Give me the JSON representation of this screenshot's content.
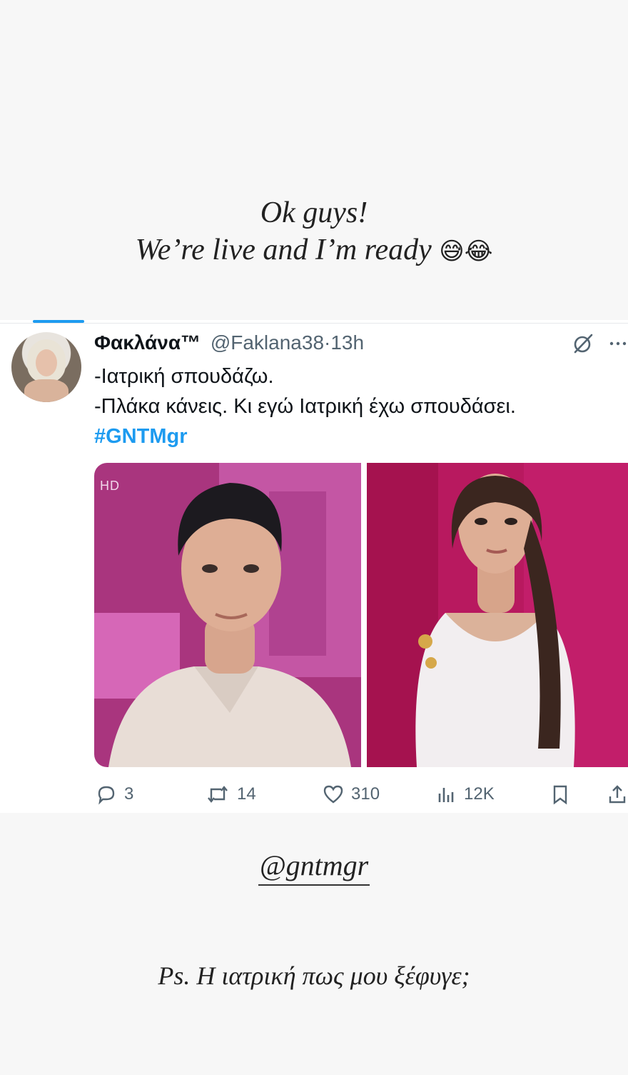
{
  "story": {
    "caption_line1": "Ok guys!",
    "caption_line2": "We’re live and I’m ready",
    "caption_emojis": "😅😂",
    "mention": "@gntmgr",
    "footnote": "Ps. Η ιατρική πως μου ξέφυγε;"
  },
  "tweet": {
    "display_name": "Φακλάνα™",
    "handle": "@Faklana38",
    "separator": "·",
    "time": "13h",
    "lines": [
      "-Ιατρική σπουδάζω.",
      "-Πλάκα κάνεις. Κι εγώ Ιατρική έχω σπουδάσει."
    ],
    "hashtag": "#GNTMgr",
    "media": {
      "left_badge": "HD"
    },
    "actions": {
      "replies": "3",
      "retweets": "14",
      "likes": "310",
      "views": "12K"
    },
    "header_icons": [
      "grok-icon",
      "more-icon"
    ]
  },
  "colors": {
    "accent": "#1d9bf0",
    "text_primary": "#0f1419",
    "text_secondary": "#536471",
    "page_bg": "#f7f7f7"
  }
}
